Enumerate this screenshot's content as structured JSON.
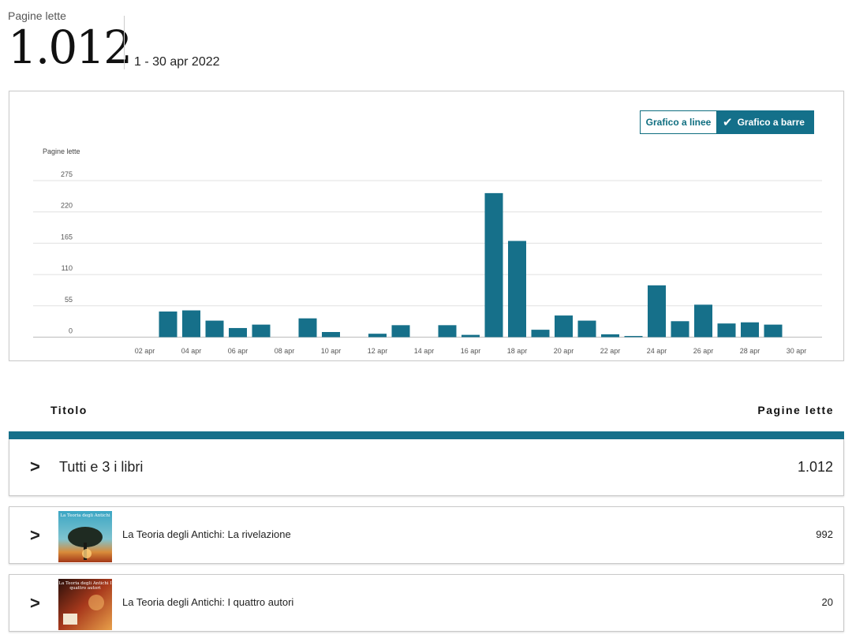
{
  "summary": {
    "label": "Pagine lette",
    "total": "1.012",
    "date_range": "1 - 30 apr 2022"
  },
  "chart_toggle": {
    "line_label": "Grafico a linee",
    "bar_label": "Grafico a barre",
    "selected": "bar",
    "check_icon": "checkmark-icon"
  },
  "chart_data": {
    "type": "bar",
    "ylabel": "Pagine lette",
    "ylim": [
      0,
      275
    ],
    "yticks": [
      0,
      55,
      110,
      165,
      220,
      275
    ],
    "grid": true,
    "x_tick_labels": [
      "02 apr",
      "04 apr",
      "06 apr",
      "08 apr",
      "10 apr",
      "12 apr",
      "14 apr",
      "16 apr",
      "18 apr",
      "20 apr",
      "22 apr",
      "24 apr",
      "26 apr",
      "28 apr",
      "30 apr"
    ],
    "categories": [
      "01 apr",
      "02 apr",
      "03 apr",
      "04 apr",
      "05 apr",
      "06 apr",
      "07 apr",
      "08 apr",
      "09 apr",
      "10 apr",
      "11 apr",
      "12 apr",
      "13 apr",
      "14 apr",
      "15 apr",
      "16 apr",
      "17 apr",
      "18 apr",
      "19 apr",
      "20 apr",
      "21 apr",
      "22 apr",
      "23 apr",
      "24 apr",
      "25 apr",
      "26 apr",
      "27 apr",
      "28 apr",
      "29 apr",
      "30 apr"
    ],
    "values": [
      0,
      0,
      45,
      47,
      29,
      16,
      22,
      0,
      33,
      9,
      0,
      6,
      21,
      0,
      21,
      4,
      253,
      169,
      13,
      38,
      29,
      5,
      2,
      91,
      28,
      57,
      24,
      26,
      22,
      0
    ],
    "bar_color": "#16708a"
  },
  "table": {
    "col_title": "Titolo",
    "col_pages": "Pagine lette",
    "header_color": "#16708a",
    "all_row": {
      "label": "Tutti e 3 i libri",
      "value": "1.012"
    },
    "books": [
      {
        "title": "La Teoria degli Antichi: La rivelazione",
        "value": "992",
        "cover_text": "La Teoria degli Antichi"
      },
      {
        "title": "La Teoria degli Antichi: I quattro autori",
        "value": "20",
        "cover_text": "La Teoria degli Antichi I quattro autori"
      }
    ]
  }
}
